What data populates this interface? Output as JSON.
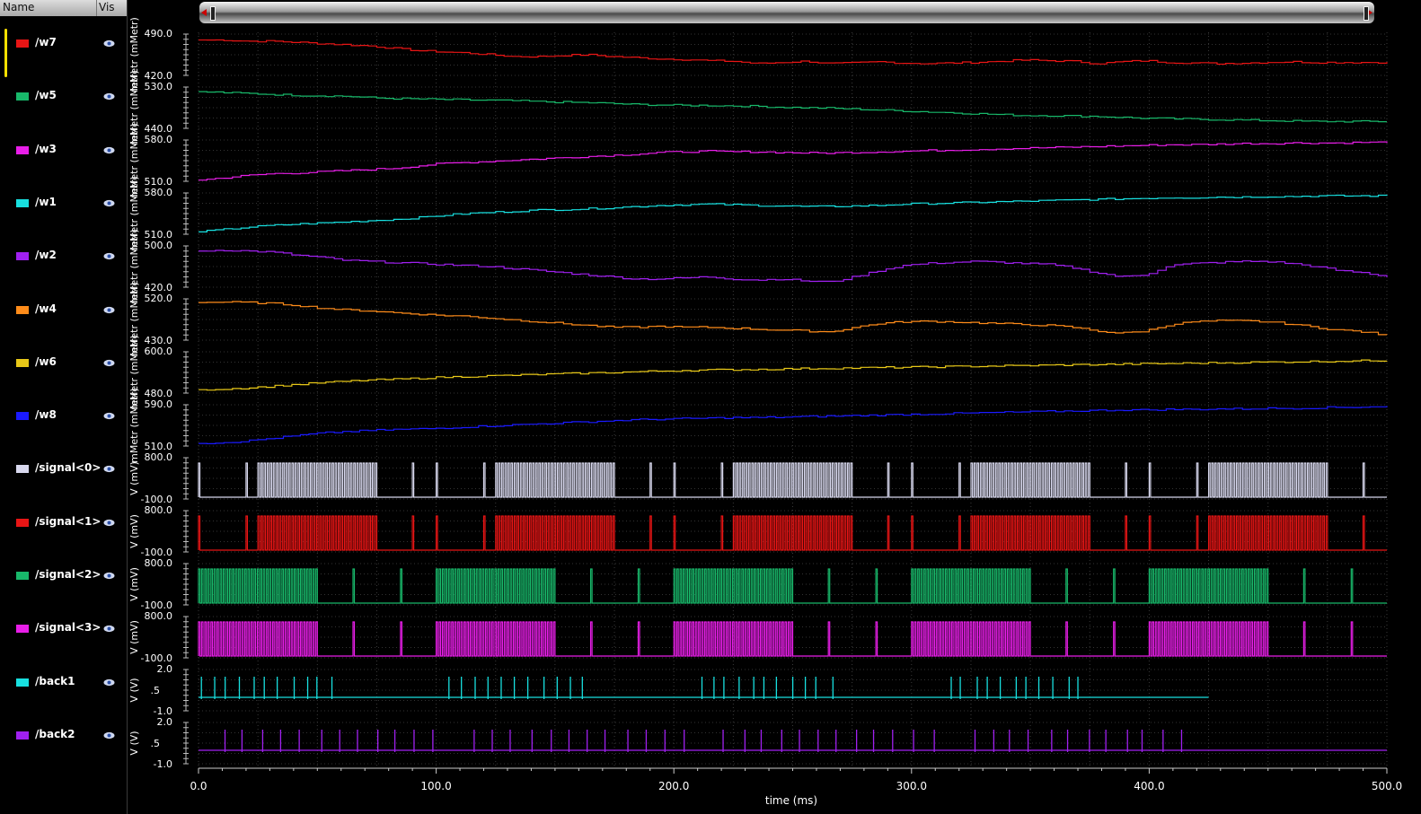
{
  "panel": {
    "name_header": "Name",
    "vis_header": "Vis"
  },
  "signals": [
    {
      "name": "/w7",
      "color": "#e81515",
      "kind": "analog",
      "ytop": "490.0",
      "ybot": "420.0",
      "unit": "mMetr (mMetr)",
      "profile": [
        480,
        480,
        478,
        478,
        476,
        474,
        472,
        470,
        466,
        462,
        460,
        458,
        455,
        452,
        452,
        454,
        455,
        452,
        450,
        448,
        447,
        445,
        444,
        440,
        442,
        444,
        440,
        441,
        443,
        441,
        440,
        441,
        442,
        444,
        446,
        445,
        444,
        440,
        443,
        445,
        442,
        441,
        440,
        441,
        442,
        443,
        442,
        442,
        442,
        442
      ]
    },
    {
      "name": "/w5",
      "color": "#18b86a",
      "kind": "analog",
      "ytop": "530.0",
      "ybot": "440.0",
      "unit": "mMetr (mMetr)",
      "profile": [
        520,
        518,
        516,
        514,
        512,
        511,
        510,
        507,
        505,
        504,
        503,
        502,
        501,
        500,
        498,
        497,
        496,
        494,
        492,
        491,
        490,
        490,
        489,
        488,
        486,
        485,
        484,
        482,
        480,
        478,
        476,
        474,
        472,
        470,
        468,
        468,
        467,
        466,
        464,
        462,
        461,
        460,
        459,
        458,
        457,
        456,
        455,
        455,
        455,
        455
      ]
    },
    {
      "name": "/w3",
      "color": "#e81ee8",
      "kind": "analog",
      "ytop": "580.0",
      "ybot": "510.0",
      "unit": "mMetr (mMetr)",
      "profile": [
        512,
        516,
        520,
        523,
        524,
        526,
        528,
        530,
        532,
        536,
        540,
        542,
        544,
        546,
        548,
        550,
        552,
        554,
        556,
        559,
        560,
        561,
        560,
        560,
        559,
        558,
        558,
        559,
        560,
        561,
        562,
        563,
        564,
        565,
        566,
        567,
        568,
        569,
        570,
        571,
        572,
        572,
        573,
        574,
        574,
        575,
        575,
        575,
        576,
        576
      ]
    },
    {
      "name": "/w1",
      "color": "#18e0e0",
      "kind": "analog",
      "ytop": "580.0",
      "ybot": "510.0",
      "unit": "mMetr (mMetr)",
      "profile": [
        514,
        518,
        522,
        525,
        527,
        529,
        531,
        533,
        535,
        538,
        542,
        545,
        547,
        549,
        551,
        552,
        553,
        555,
        557,
        559,
        560,
        561,
        560,
        559,
        558,
        557,
        557,
        558,
        559,
        561,
        562,
        563,
        564,
        565,
        566,
        567,
        568,
        569,
        570,
        571,
        572,
        572,
        573,
        573,
        574,
        574,
        575,
        575,
        575,
        575
      ]
    },
    {
      "name": "/w2",
      "color": "#a020f0",
      "kind": "analog",
      "ytop": "500.0",
      "ybot": "420.0",
      "unit": "mMetr (mMetr)",
      "profile": [
        490,
        492,
        490,
        488,
        482,
        478,
        472,
        470,
        468,
        466,
        464,
        462,
        460,
        456,
        452,
        448,
        444,
        440,
        436,
        436,
        438,
        440,
        436,
        434,
        436,
        432,
        430,
        440,
        452,
        462,
        466,
        468,
        470,
        468,
        466,
        464,
        458,
        448,
        440,
        444,
        462,
        466,
        468,
        470,
        470,
        466,
        460,
        452,
        448,
        440
      ]
    },
    {
      "name": "/w4",
      "color": "#ff8c1a",
      "kind": "analog",
      "ytop": "520.0",
      "ybot": "430.0",
      "unit": "mMetr (mMetr)",
      "profile": [
        512,
        513,
        512,
        510,
        506,
        500,
        496,
        494,
        490,
        487,
        484,
        482,
        478,
        474,
        470,
        466,
        462,
        458,
        458,
        460,
        458,
        458,
        456,
        454,
        452,
        450,
        448,
        458,
        466,
        470,
        471,
        470,
        468,
        466,
        464,
        462,
        458,
        450,
        445,
        450,
        464,
        470,
        472,
        472,
        470,
        465,
        458,
        452,
        448,
        440
      ]
    },
    {
      "name": "/w6",
      "color": "#e8c818",
      "kind": "analog",
      "ytop": "600.0",
      "ybot": "480.0",
      "unit": "mMetr (mMetr)",
      "profile": [
        490,
        492,
        495,
        500,
        505,
        510,
        514,
        518,
        520,
        523,
        526,
        528,
        530,
        532,
        534,
        536,
        538,
        540,
        542,
        544,
        546,
        547,
        548,
        549,
        550,
        551,
        552,
        553,
        554,
        555,
        556,
        557,
        558,
        559,
        560,
        561,
        562,
        563,
        564,
        565,
        566,
        567,
        568,
        569,
        570,
        571,
        572,
        573,
        574,
        575
      ]
    },
    {
      "name": "/w8",
      "color": "#1a1aff",
      "kind": "analog",
      "ytop": "590.0",
      "ybot": "510.0",
      "unit": "mMetr (mMetr)",
      "profile": [
        515,
        517,
        520,
        525,
        530,
        535,
        538,
        540,
        542,
        543,
        545,
        547,
        549,
        551,
        553,
        555,
        557,
        559,
        561,
        562,
        563,
        564,
        565,
        565,
        566,
        567,
        568,
        569,
        570,
        571,
        572,
        573,
        574,
        575,
        576,
        577,
        578,
        579,
        580,
        580,
        581,
        581,
        582,
        582,
        583,
        583,
        584,
        585,
        586,
        587
      ]
    },
    {
      "name": "/signal<0>",
      "color": "#d8d8ee",
      "kind": "digital",
      "ytop": "800.0",
      "ybot": "-100.0",
      "unit": "V (mV)",
      "phase": 0
    },
    {
      "name": "/signal<1>",
      "color": "#e81515",
      "kind": "digital",
      "ytop": "800.0",
      "ybot": "-100.0",
      "unit": "V (mV)",
      "phase": 0
    },
    {
      "name": "/signal<2>",
      "color": "#18b86a",
      "kind": "digital",
      "ytop": "800.0",
      "ybot": "-100.0",
      "unit": "V (mV)",
      "phase": 1
    },
    {
      "name": "/signal<3>",
      "color": "#e81ee8",
      "kind": "digital",
      "ytop": "800.0",
      "ybot": "-100.0",
      "unit": "V (mV)",
      "phase": 1
    },
    {
      "name": "/back1",
      "color": "#18e0e0",
      "kind": "spike",
      "ytop": "2.0",
      "ymid": ".5",
      "ybot": "-1.0",
      "unit": "V (V)",
      "phase": 0
    },
    {
      "name": "/back2",
      "color": "#a020f0",
      "kind": "spike",
      "ytop": "2.0",
      "ymid": ".5",
      "ybot": "-1.0",
      "unit": "V (V)",
      "phase": 1
    }
  ],
  "xaxis": {
    "label": "time (ms)",
    "ticks": [
      "0.0",
      "100.0",
      "200.0",
      "300.0",
      "400.0",
      "500.0"
    ]
  }
}
